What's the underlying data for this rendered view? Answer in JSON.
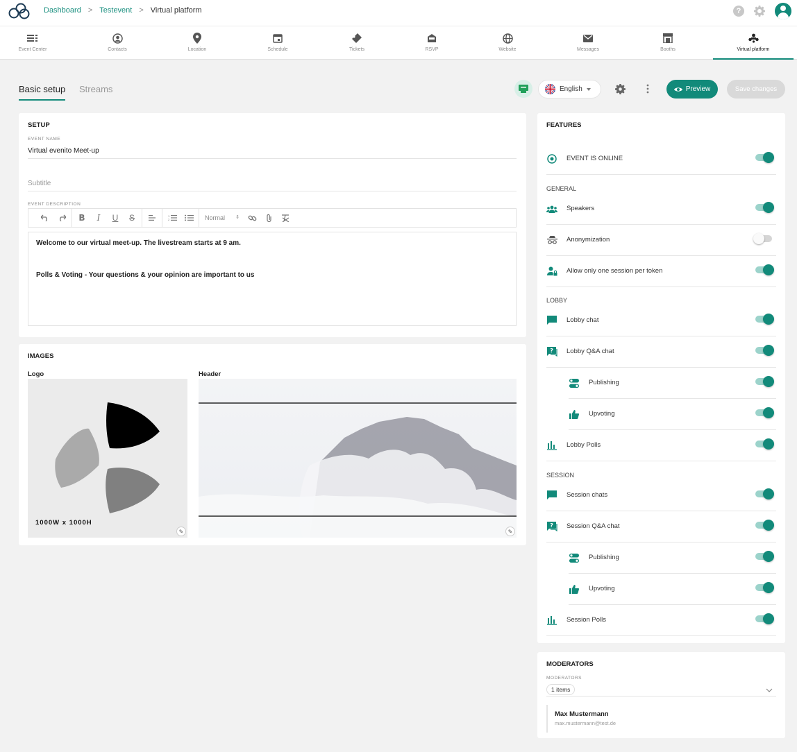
{
  "breadcrumbs": {
    "dashboard": "Dashboard",
    "event": "Testevent",
    "current": "Virtual platform",
    "sep": ">"
  },
  "topbar": {
    "help_symbol": "?"
  },
  "nav": [
    {
      "label": "Event Center",
      "icon": "event-center-icon"
    },
    {
      "label": "Contacts",
      "icon": "contacts-icon"
    },
    {
      "label": "Location",
      "icon": "location-icon"
    },
    {
      "label": "Schedule",
      "icon": "schedule-icon"
    },
    {
      "label": "Tickets",
      "icon": "tickets-icon"
    },
    {
      "label": "RSVP",
      "icon": "rsvp-icon"
    },
    {
      "label": "Website",
      "icon": "website-icon"
    },
    {
      "label": "Messages",
      "icon": "messages-icon"
    },
    {
      "label": "Booths",
      "icon": "booths-icon"
    },
    {
      "label": "Virtual platform",
      "icon": "virtual-platform-icon"
    }
  ],
  "subtabs": {
    "basic": "Basic setup",
    "streams": "Streams"
  },
  "toolbar": {
    "language": "English",
    "preview": "Preview",
    "save": "Save changes"
  },
  "setup": {
    "title": "SETUP",
    "event_name_label": "EVENT NAME",
    "event_name": "Virtual evenito Meet-up",
    "subtitle_placeholder": "Subtitle",
    "description_label": "EVENT DESCRIPTION",
    "format": "Normal",
    "description_line1": "Welcome to our virtual meet-up. The livestream starts at 9 am.",
    "description_line2": "Polls & Voting - Your questions & your opinion are important to us"
  },
  "images": {
    "title": "IMAGES",
    "logo_label": "Logo",
    "header_label": "Header",
    "logo_size": "1000W x 1000H"
  },
  "features": {
    "title": "FEATURES",
    "online": "EVENT IS ONLINE",
    "general": "GENERAL",
    "speakers": "Speakers",
    "anonymization": "Anonymization",
    "one_session": "Allow only one session per token",
    "lobby": "LOBBY",
    "lobby_chat": "Lobby chat",
    "lobby_qa": "Lobby Q&A chat",
    "publishing": "Publishing",
    "upvoting": "Upvoting",
    "lobby_polls": "Lobby Polls",
    "session": "SESSION",
    "session_chats": "Session chats",
    "session_qa": "Session Q&A chat",
    "session_polls": "Session Polls"
  },
  "moderators": {
    "title": "MODERATORS",
    "label": "MODERATORS",
    "count": "1 items",
    "name": "Max Mustermann",
    "email": "max.mustermann@test.de"
  },
  "colors": {
    "accent": "#128a7a",
    "background": "#f2f2f2"
  }
}
